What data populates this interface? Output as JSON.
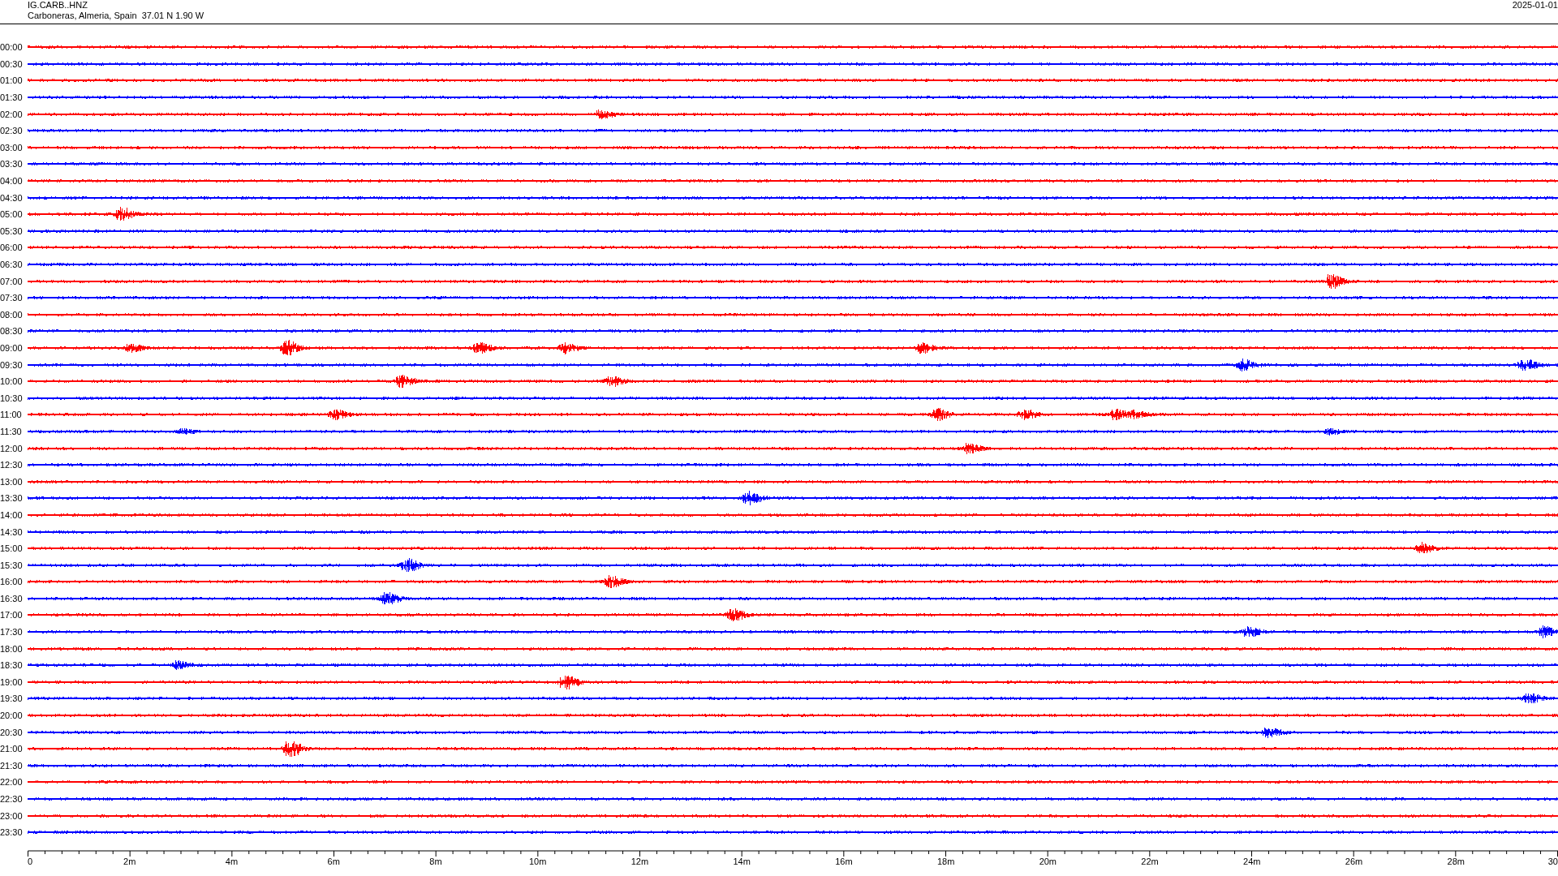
{
  "header": {
    "station": "IG.CARB..HNZ",
    "location": "Carboneras, Almeria, Spain  37.01 N 1.90 W",
    "date": "2025-01-01"
  },
  "traces": [
    {
      "time": "00:00",
      "color": "#ff0000"
    },
    {
      "time": "00:30",
      "color": "#0000ff"
    },
    {
      "time": "01:00",
      "color": "#ff0000"
    },
    {
      "time": "01:30",
      "color": "#0000ff"
    },
    {
      "time": "02:00",
      "color": "#ff0000"
    },
    {
      "time": "02:30",
      "color": "#0000ff"
    },
    {
      "time": "03:00",
      "color": "#ff0000"
    },
    {
      "time": "03:30",
      "color": "#0000ff"
    },
    {
      "time": "04:00",
      "color": "#ff0000"
    },
    {
      "time": "04:30",
      "color": "#0000ff"
    },
    {
      "time": "05:00",
      "color": "#ff0000"
    },
    {
      "time": "05:30",
      "color": "#0000ff"
    },
    {
      "time": "06:00",
      "color": "#ff0000"
    },
    {
      "time": "06:30",
      "color": "#0000ff"
    },
    {
      "time": "07:00",
      "color": "#ff0000"
    },
    {
      "time": "07:30",
      "color": "#0000ff"
    },
    {
      "time": "08:00",
      "color": "#ff0000"
    },
    {
      "time": "08:30",
      "color": "#0000ff"
    },
    {
      "time": "09:00",
      "color": "#ff0000"
    },
    {
      "time": "09:30",
      "color": "#0000ff"
    },
    {
      "time": "10:00",
      "color": "#ff0000"
    },
    {
      "time": "10:30",
      "color": "#0000ff"
    },
    {
      "time": "11:00",
      "color": "#ff0000"
    },
    {
      "time": "11:30",
      "color": "#0000ff"
    },
    {
      "time": "12:00",
      "color": "#ff0000"
    },
    {
      "time": "12:30",
      "color": "#0000ff"
    },
    {
      "time": "13:00",
      "color": "#ff0000"
    },
    {
      "time": "13:30",
      "color": "#0000ff"
    },
    {
      "time": "14:00",
      "color": "#ff0000"
    },
    {
      "time": "14:30",
      "color": "#0000ff"
    },
    {
      "time": "15:00",
      "color": "#ff0000"
    },
    {
      "time": "15:30",
      "color": "#0000ff"
    },
    {
      "time": "16:00",
      "color": "#ff0000"
    },
    {
      "time": "16:30",
      "color": "#0000ff"
    },
    {
      "time": "17:00",
      "color": "#ff0000"
    },
    {
      "time": "17:30",
      "color": "#0000ff"
    },
    {
      "time": "18:00",
      "color": "#ff0000"
    },
    {
      "time": "18:30",
      "color": "#0000ff"
    },
    {
      "time": "19:00",
      "color": "#ff0000"
    },
    {
      "time": "19:30",
      "color": "#0000ff"
    },
    {
      "time": "20:00",
      "color": "#ff0000"
    },
    {
      "time": "20:30",
      "color": "#0000ff"
    },
    {
      "time": "21:00",
      "color": "#ff0000"
    },
    {
      "time": "21:30",
      "color": "#0000ff"
    },
    {
      "time": "22:00",
      "color": "#ff0000"
    },
    {
      "time": "22:30",
      "color": "#0000ff"
    },
    {
      "time": "23:00",
      "color": "#ff0000"
    },
    {
      "time": "23:30",
      "color": "#0000ff"
    }
  ],
  "axis": {
    "ticks": [
      "0",
      "2m",
      "4m",
      "6m",
      "8m",
      "10m",
      "12m",
      "14m",
      "16m",
      "18m",
      "20m",
      "22m",
      "24m",
      "26m",
      "28m",
      "30"
    ]
  }
}
